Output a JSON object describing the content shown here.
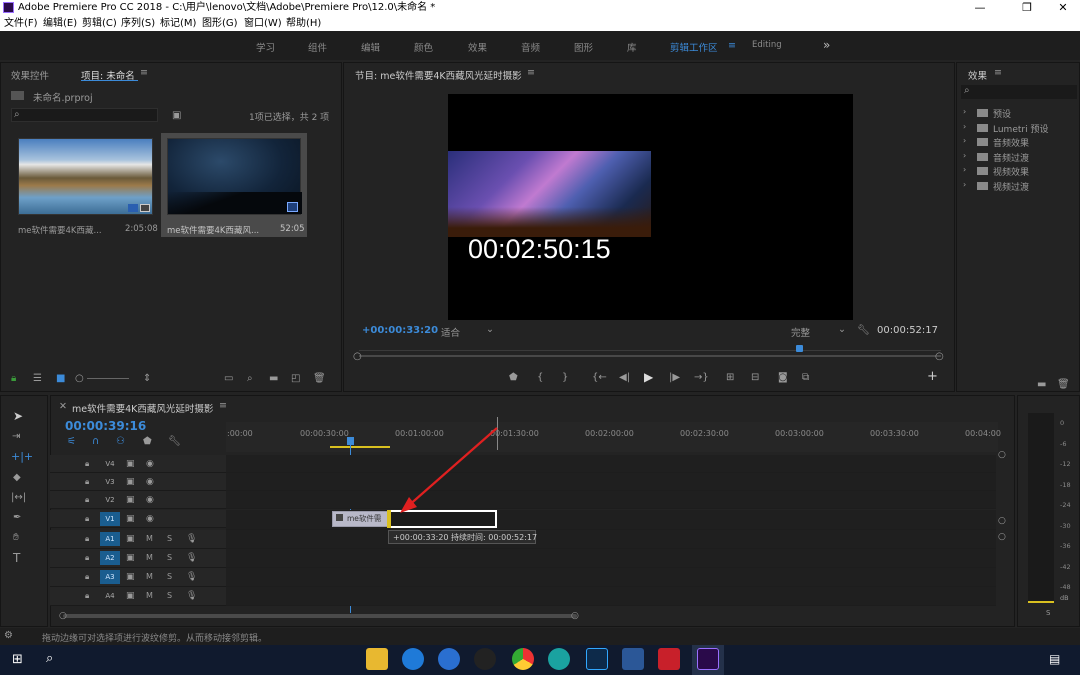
{
  "window": {
    "title": "Adobe Premiere Pro CC 2018 - C:\\用户\\lenovo\\文档\\Adobe\\Premiere Pro\\12.0\\未命名 *",
    "min": "—",
    "max": "❐",
    "close": "✕"
  },
  "menu": [
    "文件(F)",
    "编辑(E)",
    "剪辑(C)",
    "序列(S)",
    "标记(M)",
    "图形(G)",
    "窗口(W)",
    "帮助(H)"
  ],
  "workspaces": [
    "学习",
    "组件",
    "编辑",
    "颜色",
    "效果",
    "音频",
    "图形",
    "库",
    "剪辑工作区",
    "Editing"
  ],
  "workspace_active": "剪辑工作区",
  "workspace_more": "»",
  "project": {
    "tab_effects_controls": "效果控件",
    "tab_project": "项目: 未命名",
    "file": "未命名.prproj",
    "selection_info": "1项已选择，共 2 项",
    "clips": [
      {
        "name": "me软件需要4K西藏...",
        "duration": "2:05:08"
      },
      {
        "name": "me软件需要4K西藏风...",
        "duration": "52:05"
      }
    ]
  },
  "program": {
    "title": "节目: me软件需要4K西藏风光延时摄影",
    "overlay_timecode": "00:02:50:15",
    "current_time": "+00:00:33:20",
    "fit": "适合",
    "quality": "完整",
    "duration": "00:00:52:17"
  },
  "effects": {
    "title": "效果",
    "items": [
      "预设",
      "Lumetri 预设",
      "音频效果",
      "音频过渡",
      "视频效果",
      "视频过渡"
    ]
  },
  "timeline": {
    "sequence_title": "me软件需要4K西藏风光延时摄影",
    "timecode": "00:00:39:16",
    "ruler": [
      ":00:00",
      "00:00:30:00",
      "00:01:00:00",
      "00:01:30:00",
      "00:02:00:00",
      "00:02:30:00",
      "00:03:00:00",
      "00:03:30:00",
      "00:04:00"
    ],
    "video_tracks": [
      "V4",
      "V3",
      "V2",
      "V1"
    ],
    "audio_tracks": [
      "A1",
      "A2",
      "A3",
      "A4"
    ],
    "clip_label": "me软件需",
    "tooltip": "+00:00:33:20 持续时间: 00:00:52:17",
    "m": "M",
    "s": "S"
  },
  "audio_meter": {
    "scale": [
      "0",
      "-6",
      "-12",
      "-18",
      "-24",
      "-30",
      "-36",
      "-42",
      "-48",
      "dB"
    ],
    "solo": "S"
  },
  "status_text": "拖动边缘可对选择项进行波纹修剪。从而移动接邻剪辑。",
  "colors": {
    "accent": "#3c8bd9",
    "tooltip_arrow": "#e02020",
    "clip_marker": "#d9c020"
  }
}
